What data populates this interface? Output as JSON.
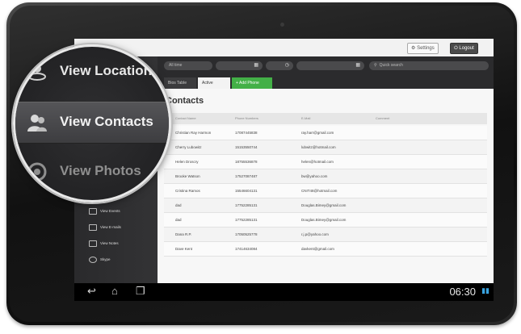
{
  "topbar": {
    "settings_label": "Settings",
    "logout_label": "Logout"
  },
  "filters": {
    "range_label": "All time",
    "search_placeholder": "Quick search"
  },
  "tabs": [
    {
      "label": "Bios Table"
    },
    {
      "label": "Active"
    },
    {
      "label": "+ Add Phone"
    }
  ],
  "contacts": {
    "title": "Contacts",
    "columns": [
      "Contact Name",
      "Phone Numbers",
      "E-Mail",
      "Comment"
    ],
    "rows": [
      {
        "name": "Christian Ray Harmon",
        "phone": "17087445838",
        "email": "ray.harr@gmail.com"
      },
      {
        "name": "Cherry Lubowitz",
        "phone": "15153550744",
        "email": "lubwitz@hotmail.com"
      },
      {
        "name": "Helen Droscry",
        "phone": "18755536878",
        "email": "helen@hotmail.com"
      },
      {
        "name": "Brooke Watson",
        "phone": "17527087487",
        "email": "bw@yahoo.com"
      },
      {
        "name": "Cristina Ramos",
        "phone": "15546604131",
        "email": "CNIT48@hotmail.com"
      },
      {
        "name": "dad",
        "phone": "17752285131",
        "email": "Douglas.Bimey@gmail.com"
      },
      {
        "name": "dad",
        "phone": "17752285131",
        "email": "Douglas.Bimey@gmail.com"
      },
      {
        "name": "Dana R.P.",
        "phone": "17050525778",
        "email": "r.j.p@yahoo.com"
      },
      {
        "name": "Dave Kent",
        "phone": "17414634084",
        "email": "davkent@gmail.com"
      }
    ]
  },
  "sidebar_small": [
    {
      "label": "View Videos"
    },
    {
      "label": "View Events"
    },
    {
      "label": "View E-mails"
    },
    {
      "label": "View Notes"
    },
    {
      "label": "Skype"
    }
  ],
  "magnifier": {
    "items": [
      {
        "label": "View Locations",
        "icon": "location-icon"
      },
      {
        "label": "View Contacts",
        "icon": "contacts-icon"
      },
      {
        "label": "View Photos",
        "icon": "photos-icon"
      }
    ]
  },
  "navbar": {
    "clock": "06:30"
  },
  "colors": {
    "accent_green": "#43b047",
    "wifi_blue": "#39a3e0"
  }
}
